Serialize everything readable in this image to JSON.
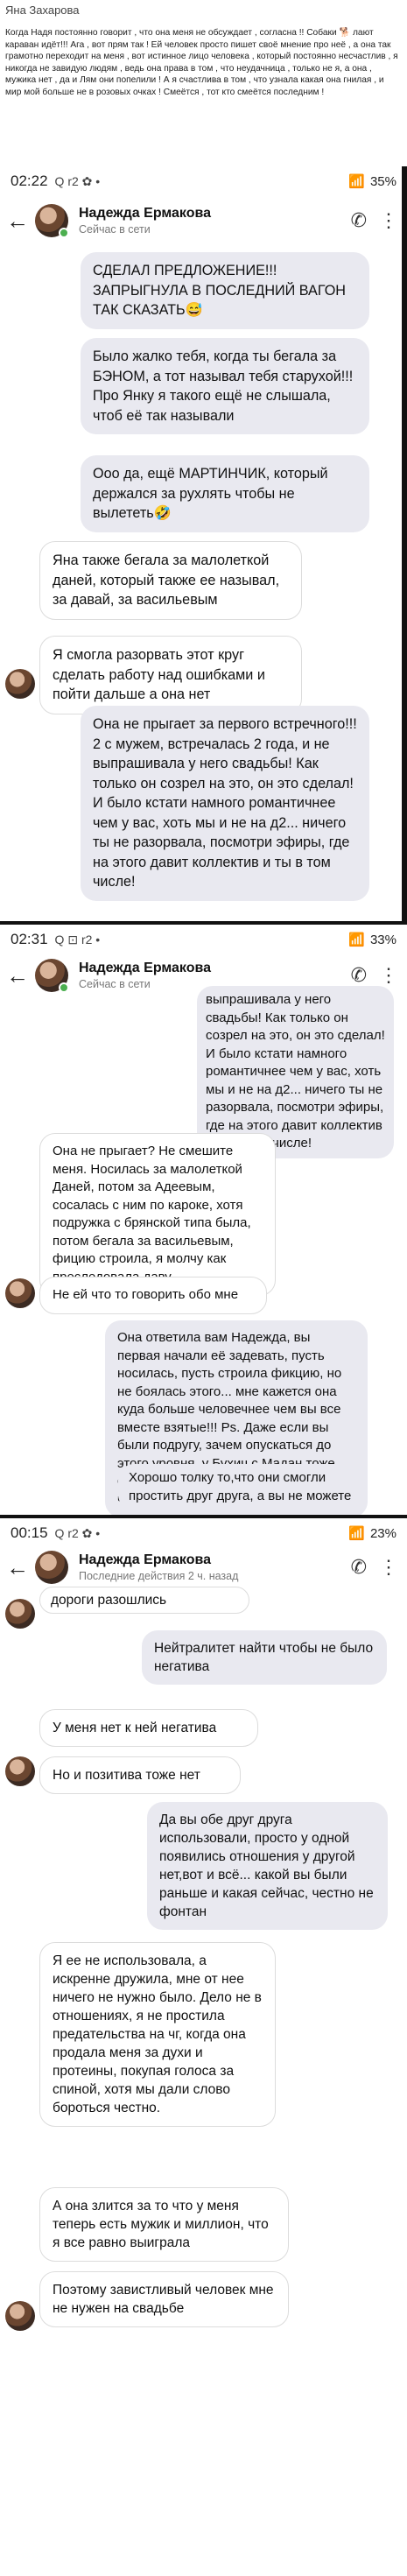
{
  "post": {
    "author": "Яна Захарова",
    "text": "Когда Надя постоянно говорит , что она меня не обсуждает , согласна !! Собаки 🐕 лают караван идёт!!! Ага , вот прям так ! Ей человек просто пишет своё мнение про неё , а она так грамотно переходит на меня , вот истинное лицо человека , который постоянно несчастлив , я никогда не завидую людям , ведь она права в том , что неудачница , только не я, а она , мужика нет , да и Лям они попелили ! А я счастлива в том , что узнала какая она гнилая , и мир мой больше не в розовых очках ! Смеётся , тот кто смеётся последним !"
  },
  "screens": [
    {
      "status": {
        "time": "02:22",
        "icons": "Q r2 ✿ •",
        "battery": "35%"
      },
      "contact": {
        "name": "Надежда Ермакова",
        "status": "Сейчас в сети"
      },
      "messages": [
        {
          "side": "out",
          "text": "СДЕЛАЛ ПРЕДЛОЖЕНИЕ!!! ЗАПРЫГНУЛА В ПОСЛЕДНИЙ ВАГОН ТАК СКАЗАТЬ😅"
        },
        {
          "side": "out",
          "text": "Было жалко тебя, когда ты бегала за БЭНОМ, а тот называл тебя старухой!!! Про Янку я такого ещё не слышала, чтоб её так называли"
        },
        {
          "side": "out",
          "text": "Ооо да, ещё МАРТИНЧИК, который держался за рухлять чтобы не вылететь🤣"
        },
        {
          "side": "in",
          "text": "Яна также бегала за малолеткой даней, который также ее называл, за давай, за васильевым"
        },
        {
          "side": "in",
          "text": "Я смогла разорвать этот круг сделать работу над ошибками и пойти дальше а она нет"
        },
        {
          "side": "out",
          "text": "Она не прыгает за первого встречного!!! 2 с мужем, встречалась 2 года, и не выпрашивала у него свадьбы! Как только он созрел на это, он это сделал! И было кстати намного романтичнее чем у вас, хоть мы и не на д2... ничего ты не разорвала, посмотри эфиры, где на этого давит коллектив и ты в том числе!"
        }
      ]
    },
    {
      "status": {
        "time": "02:31",
        "icons": "Q ⊡ r2 •",
        "battery": "33%"
      },
      "contact": {
        "name": "Надежда Ермакова",
        "status": "Сейчас в сети"
      },
      "messages": [
        {
          "side": "out",
          "text": "выпрашивала у него свадьбы! Как только он созрел на это, он это сделал! И было кстати намного романтичнее чем у вас, хоть мы и не на д2... ничего ты не разорвала, посмотри эфиры, где на этого давит коллектив и ты в том числе!"
        },
        {
          "side": "in",
          "text": "Она не прыгает? Не смешите меня. Носилась за малолеткой Даней, потом за Адеевым, сосалась с ним по кароке, хотя подружка с брянской типа была, потом бегала за васильевым, фицию строила, я молчу как преследовала даву."
        },
        {
          "side": "in",
          "text": "Не ей что то говорить обо мне"
        },
        {
          "side": "out",
          "text": "Она ответила вам Надежда, вы первая начали её задевать, пусть носилась, пусть строила фикцию, но не боялась этого... мне кажется она куда больше человечнее чем вы все вместе взятые!!! Ps. Даже если вы были подругу, зачем опускаться до этого уровня, у Бухич с Мадан тоже самое было, секреты все раскрыли, и что хорошего из этого вышло🙆‍♀️"
        },
        {
          "side": "out",
          "text": "Хорошо толку то,что они смогли простить друг друга, а вы не можете"
        }
      ]
    },
    {
      "status": {
        "time": "00:15",
        "icons": "Q r2 ✿ •",
        "battery": "23%"
      },
      "contact": {
        "name": "Надежда Ермакова",
        "status": "Последние действия 2 ч. назад"
      },
      "messages": [
        {
          "side": "in",
          "text": "дороги разошлись"
        },
        {
          "side": "out",
          "text": "Нейтралитет найти чтобы не было негатива"
        },
        {
          "side": "in",
          "text": "У меня нет к ней негатива"
        },
        {
          "side": "in",
          "text": "Но и позитива тоже нет"
        },
        {
          "side": "out",
          "text": "Да вы обе друг друга использовали, просто у одной появились отношения у другой нет,вот и всё... какой вы были раньше и какая сейчас, честно не фонтан"
        },
        {
          "side": "in",
          "text": "Я ее не использовала, а искренне дружила, мне от нее ничего не нужно было. Дело не в отношениях, я не простила предательства на чг, когда она продала меня за духи и протеины, покупая голоса за спиной, хотя мы дали слово бороться честно."
        },
        {
          "side": "in",
          "text": "А она злится за то что у меня теперь есть мужик и миллион, что я все равно выиграла"
        },
        {
          "side": "in",
          "text": "Поэтому завистливый человек мне не нужен на свадьбе"
        }
      ]
    }
  ]
}
